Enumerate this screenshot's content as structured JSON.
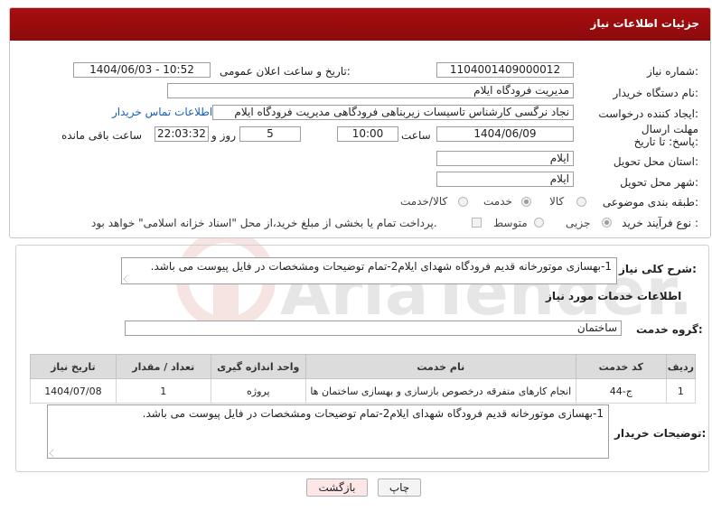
{
  "header": {
    "title": "جزئیات اطلاعات نیاز"
  },
  "fields": {
    "need_number_label": "شماره نیاز:",
    "need_number": "1104001409000012",
    "announce_label": "تاریخ و ساعت اعلان عمومی:",
    "announce_value": "1404/06/03 - 10:52",
    "buyer_org_label": "نام دستگاه خریدار:",
    "buyer_org": "مدیریت فرودگاه ایلام",
    "requester_label": "ایجاد کننده درخواست:",
    "requester": "نجاد نرگسی کارشناس تاسیسات زیربناهی فرودگاهی مدیریت فرودگاه ایلام",
    "contact_link": "اطلاعات تماس خریدار",
    "deadline_label": "مهلت ارسال پاسخ: تا تاریخ:",
    "deadline_date": "1404/06/09",
    "time_label": "ساعت",
    "deadline_time": "10:00",
    "days_value": "5",
    "days_label": "روز و",
    "remaining_time": "22:03:32",
    "remaining_label": "ساعت باقی مانده",
    "province_label": "استان محل تحویل:",
    "province": "ایلام",
    "city_label": "شهر محل تحویل:",
    "city": "ایلام",
    "category_label": "طبقه بندی موضوعی:",
    "category_options": [
      "کالا",
      "خدمت",
      "کالا/خدمت"
    ],
    "process_label": "نوع فرآیند خرید :",
    "process_options": [
      "جزیی",
      "متوسط"
    ],
    "treasury_note": "پرداخت تمام یا بخشی از مبلغ خرید،از محل \"اسناد خزانه اسلامی\" خواهد بود."
  },
  "summary": {
    "label": "شرح کلی نیاز:",
    "text": "1-بهسازی موتورخانه قدیم فرودگاه شهدای ایلام2-تمام توضیحات ومشخصات در فایل پیوست می باشد."
  },
  "services": {
    "section_title": "اطلاعات خدمات مورد نیاز",
    "group_label": "گروه خدمت:",
    "group_value": "ساختمان",
    "columns": [
      "ردیف",
      "کد خدمت",
      "نام خدمت",
      "واحد اندازه گیری",
      "تعداد / مقدار",
      "تاریخ نیاز"
    ],
    "rows": [
      [
        "1",
        "ج-44",
        "انجام کارهای متفرقه درخصوص بازسازی و بهسازی ساختمان ها",
        "پروژه",
        "1",
        "1404/07/08"
      ]
    ]
  },
  "buyer_notes": {
    "label": "توضیحات خریدار:",
    "text": "1-بهسازی موتورخانه قدیم فرودگاه شهدای ایلام2-تمام توضیحات ومشخصات در فایل پیوست می باشد."
  },
  "buttons": {
    "print": "چاپ",
    "back": "بازگشت"
  },
  "watermark": {
    "text": "AriaTender.neT"
  },
  "colors": {
    "header_bg": "#9b0d0f",
    "link": "#1a5fb4",
    "back_button_bg": "#fde6e6"
  }
}
